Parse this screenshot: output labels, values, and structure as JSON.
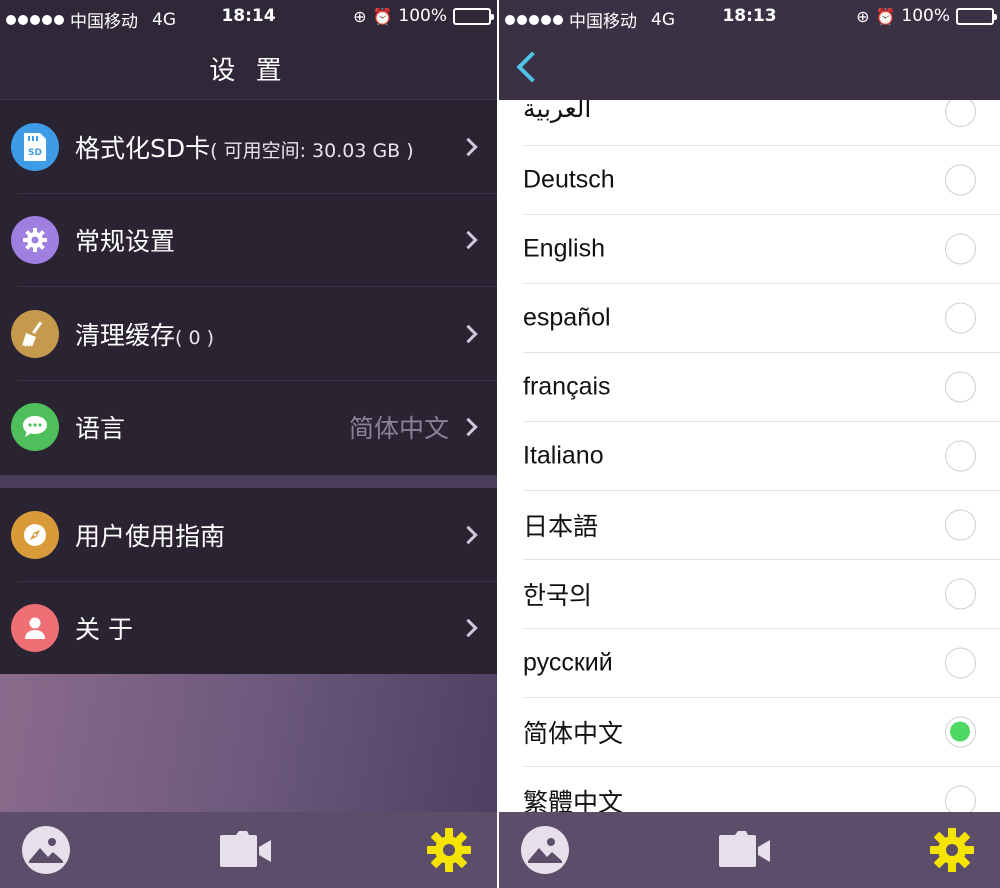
{
  "left": {
    "status": {
      "carrier": "中国移动",
      "network": "4G",
      "time": "18:14",
      "battery": "100%"
    },
    "title": "设 置",
    "group1": [
      {
        "label": "格式化SD卡",
        "note": "( 可用空间: 30.03 GB )",
        "value": "",
        "icon": "sd-card-icon"
      },
      {
        "label": "常规设置",
        "note": "",
        "value": "",
        "icon": "gear-icon"
      },
      {
        "label": "清理缓存",
        "note": "( 0 )",
        "value": "",
        "icon": "broom-icon"
      },
      {
        "label": "语言",
        "note": "",
        "value": "简体中文",
        "icon": "chat-bubble-icon"
      }
    ],
    "group2": [
      {
        "label": "用户使用指南",
        "icon": "compass-icon"
      },
      {
        "label": "关 于",
        "icon": "person-icon"
      }
    ]
  },
  "right": {
    "status": {
      "carrier": "中国移动",
      "network": "4G",
      "time": "18:13",
      "battery": "100%"
    },
    "languages": [
      {
        "name": "العربية",
        "selected": false
      },
      {
        "name": "Deutsch",
        "selected": false
      },
      {
        "name": "English",
        "selected": false
      },
      {
        "name": "español",
        "selected": false
      },
      {
        "name": "français",
        "selected": false
      },
      {
        "name": "Italiano",
        "selected": false
      },
      {
        "name": "日本語",
        "selected": false
      },
      {
        "name": "한국의",
        "selected": false
      },
      {
        "name": "русский",
        "selected": false
      },
      {
        "name": "简体中文",
        "selected": true
      },
      {
        "name": "繁體中文",
        "selected": false
      }
    ]
  },
  "tabbar": {
    "items": [
      "photo-gallery-icon",
      "video-camera-icon",
      "settings-gear-icon"
    ],
    "active_color": "#f5e400",
    "inactive_color": "#e6e0ea"
  },
  "colors": {
    "accent_back": "#4fc3e8",
    "radio_selected": "#4cd964"
  }
}
